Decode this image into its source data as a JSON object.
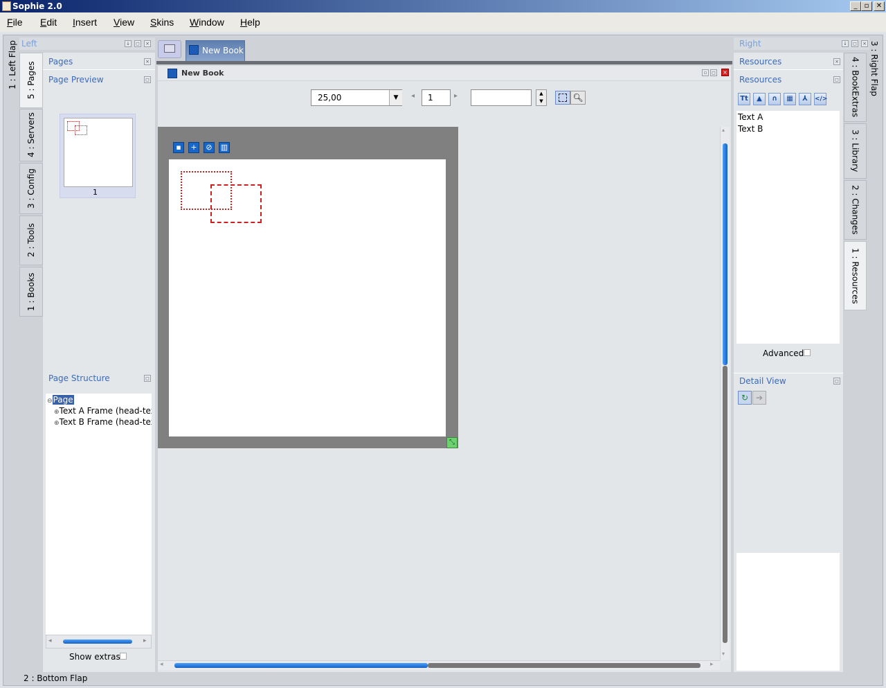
{
  "window": {
    "title": "Sophie 2.0",
    "minimize": "_",
    "maximize": "▫",
    "close": "✕"
  },
  "menu": [
    "File",
    "Edit",
    "Insert",
    "View",
    "Skins",
    "Window",
    "Help"
  ],
  "left_flap": {
    "flap_label": "1 : Left Flap",
    "header": "Left",
    "tabs": [
      "5 : Pages",
      "4 : Servers",
      "3 : Config",
      "2 : Tools",
      "1 : Books"
    ],
    "pages_title": "Pages",
    "page_preview_title": "Page Preview",
    "page_number": "1",
    "page_structure_title": "Page Structure",
    "tree": {
      "root": "Page",
      "children": [
        "Text A Frame (head-text-",
        "Text B Frame (head-text-"
      ]
    },
    "show_extras": "Show extras"
  },
  "doc_tabs": {
    "book_tab": "New Book"
  },
  "editor": {
    "title": "New Book",
    "zoom": "25,00",
    "page_field": "1",
    "extra_field": ""
  },
  "right_flap": {
    "header": "Right",
    "flap_label": "3 : Right Flap",
    "tabs": [
      "4 : BookExtras",
      "3 : Library",
      "2 : Changes",
      "1 : Resources"
    ],
    "resources_title": "Resources",
    "resources_sub_title": "Resources",
    "resource_toolbar": [
      "text-icon",
      "image-icon",
      "audio-icon",
      "video-icon",
      "pdf-icon",
      "html-icon"
    ],
    "resource_items": [
      "Text A",
      "Text B"
    ],
    "advanced": "Advanced",
    "detail_view_title": "Detail View"
  },
  "bottom_flap": {
    "label": "2 : Bottom Flap"
  }
}
